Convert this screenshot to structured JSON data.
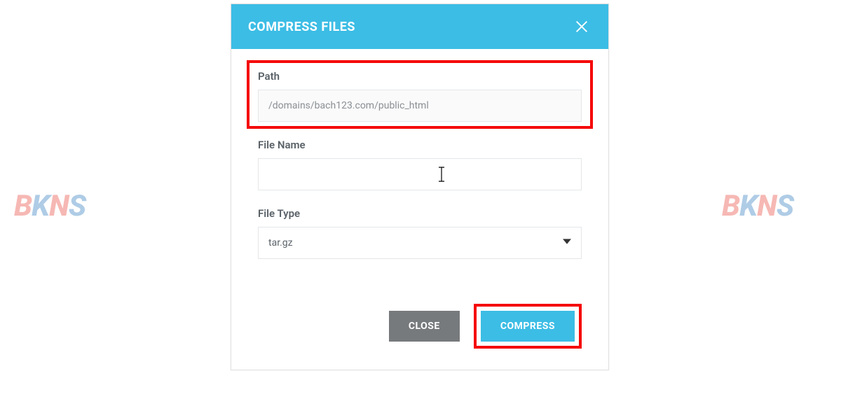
{
  "modal": {
    "title": "COMPRESS FILES",
    "path": {
      "label": "Path",
      "value": "/domains/bach123.com/public_html"
    },
    "filename": {
      "label": "File Name",
      "value": ""
    },
    "filetype": {
      "label": "File Type",
      "selected": "tar.gz"
    },
    "buttons": {
      "close": "CLOSE",
      "compress": "COMPRESS"
    }
  },
  "watermark": {
    "text": "BKNS"
  }
}
